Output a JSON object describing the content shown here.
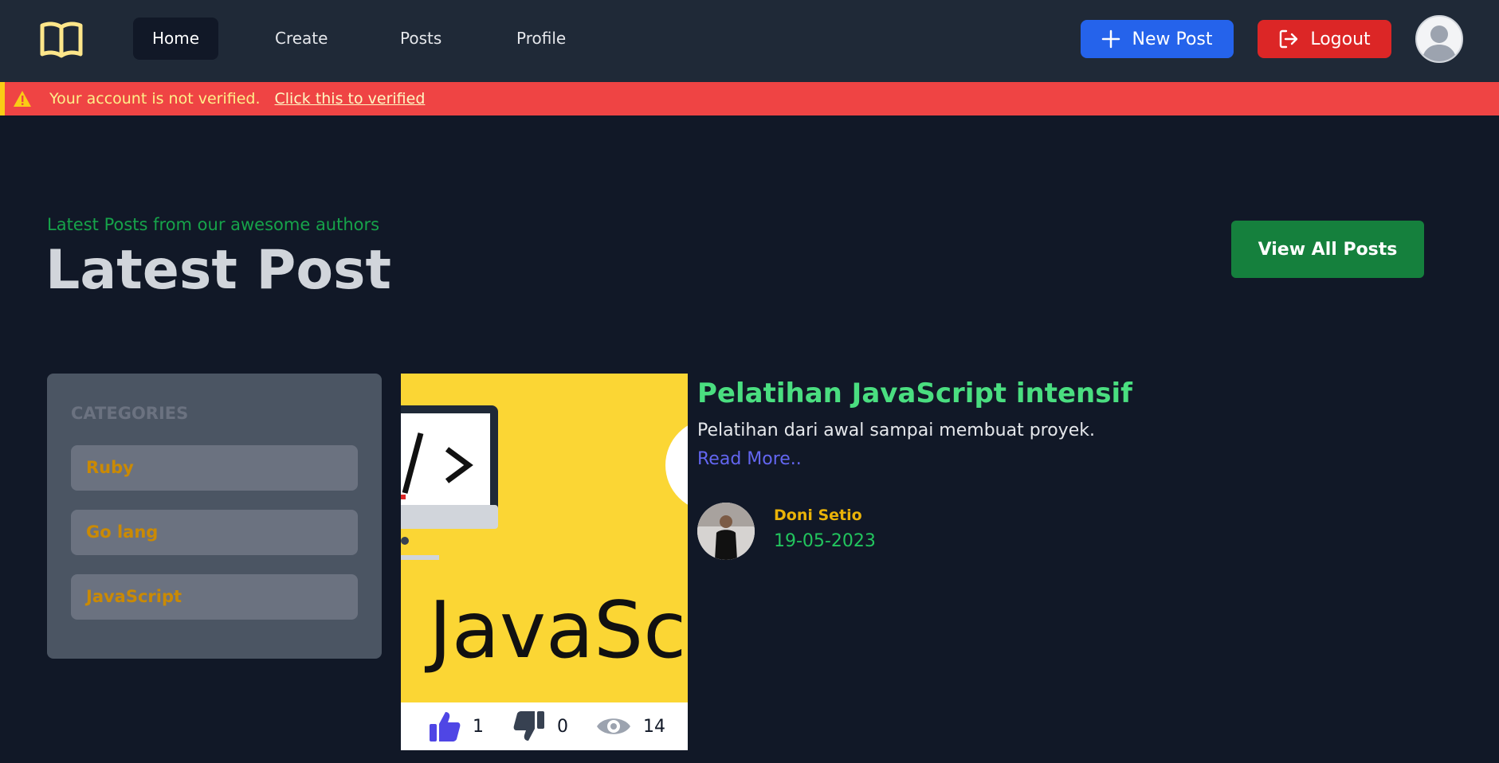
{
  "nav": {
    "links": [
      "Home",
      "Create",
      "Posts",
      "Profile"
    ],
    "new_post": "New Post",
    "logout": "Logout",
    "logo_icon": "book-icon",
    "avatar_icon": "user-avatar-icon"
  },
  "alert": {
    "message": "Your account is not verified.",
    "link": "Click this to verified",
    "icon": "warning-icon"
  },
  "header": {
    "subtitle": "Latest Posts from our awesome authors",
    "title": "Latest Post",
    "view_all": "View All Posts"
  },
  "categories": {
    "heading": "CATEGORIES",
    "items": [
      "Ruby",
      "Go lang",
      "JavaScript"
    ]
  },
  "post": {
    "image_text": "JavaScri",
    "title": "Pelatihan JavaScript intensif",
    "description": "Pelatihan dari awal sampai membuat proyek.",
    "read_more": "Read More..",
    "author": "Doni Setio",
    "date": "19-05-2023",
    "likes": "1",
    "dislikes": "0",
    "views": "14"
  },
  "colors": {
    "navbar": "#1f2937",
    "background": "#111827",
    "alert": "#ef4444",
    "new_post": "#2563eb",
    "logout": "#dc2626",
    "view_all": "#15803d",
    "post_title": "#4ade80"
  }
}
